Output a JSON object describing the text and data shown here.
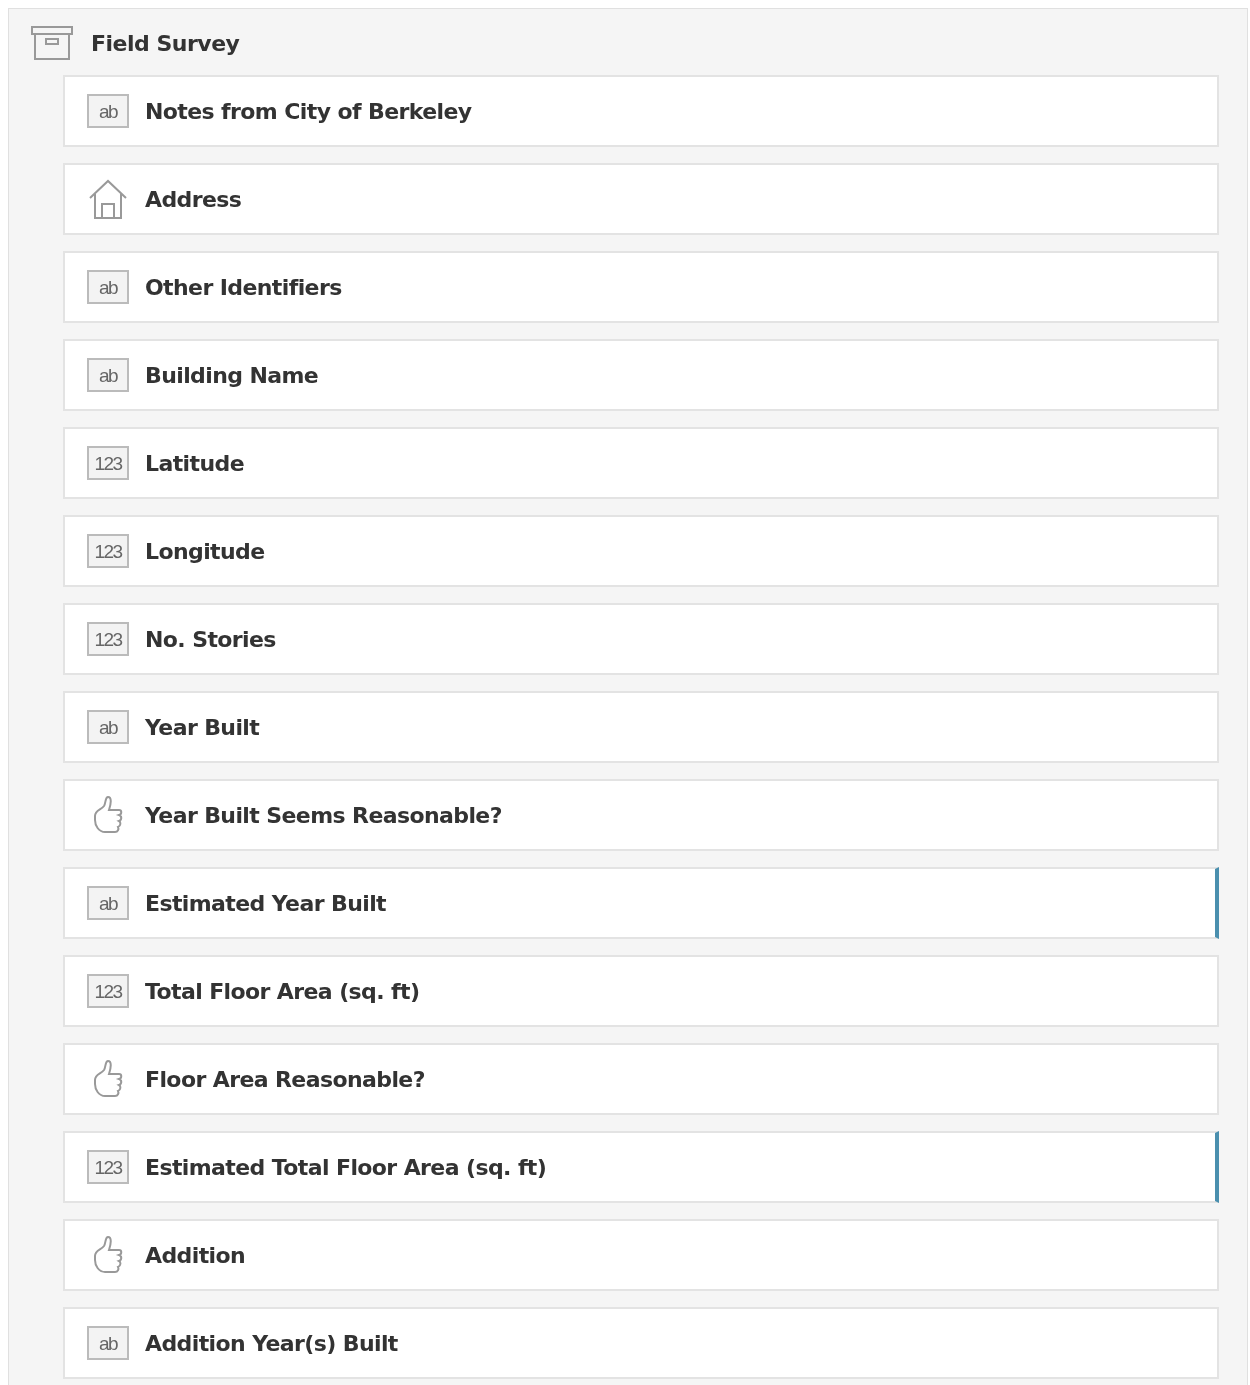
{
  "group": {
    "title": "Field Survey"
  },
  "fields": [
    {
      "label": "Notes from City of Berkeley",
      "kind": "text",
      "icon_text": "ab",
      "marked": false
    },
    {
      "label": "Address",
      "kind": "address",
      "marked": false
    },
    {
      "label": "Other Identifiers",
      "kind": "text",
      "icon_text": "ab",
      "marked": false
    },
    {
      "label": "Building Name",
      "kind": "text",
      "icon_text": "ab",
      "marked": false
    },
    {
      "label": "Latitude",
      "kind": "number",
      "icon_text": "123",
      "marked": false
    },
    {
      "label": "Longitude",
      "kind": "number",
      "icon_text": "123",
      "marked": false
    },
    {
      "label": "No. Stories",
      "kind": "number",
      "icon_text": "123",
      "marked": false
    },
    {
      "label": "Year Built",
      "kind": "text",
      "icon_text": "ab",
      "marked": false
    },
    {
      "label": "Year Built Seems Reasonable?",
      "kind": "yesno",
      "marked": false
    },
    {
      "label": "Estimated Year Built",
      "kind": "text",
      "icon_text": "ab",
      "marked": true
    },
    {
      "label": "Total Floor Area (sq. ft)",
      "kind": "number",
      "icon_text": "123",
      "marked": false
    },
    {
      "label": "Floor Area Reasonable?",
      "kind": "yesno",
      "marked": false
    },
    {
      "label": "Estimated Total Floor Area (sq. ft)",
      "kind": "number",
      "icon_text": "123",
      "marked": true
    },
    {
      "label": "Addition",
      "kind": "yesno",
      "marked": false
    },
    {
      "label": "Addition Year(s) Built",
      "kind": "text",
      "icon_text": "ab",
      "marked": false
    }
  ]
}
